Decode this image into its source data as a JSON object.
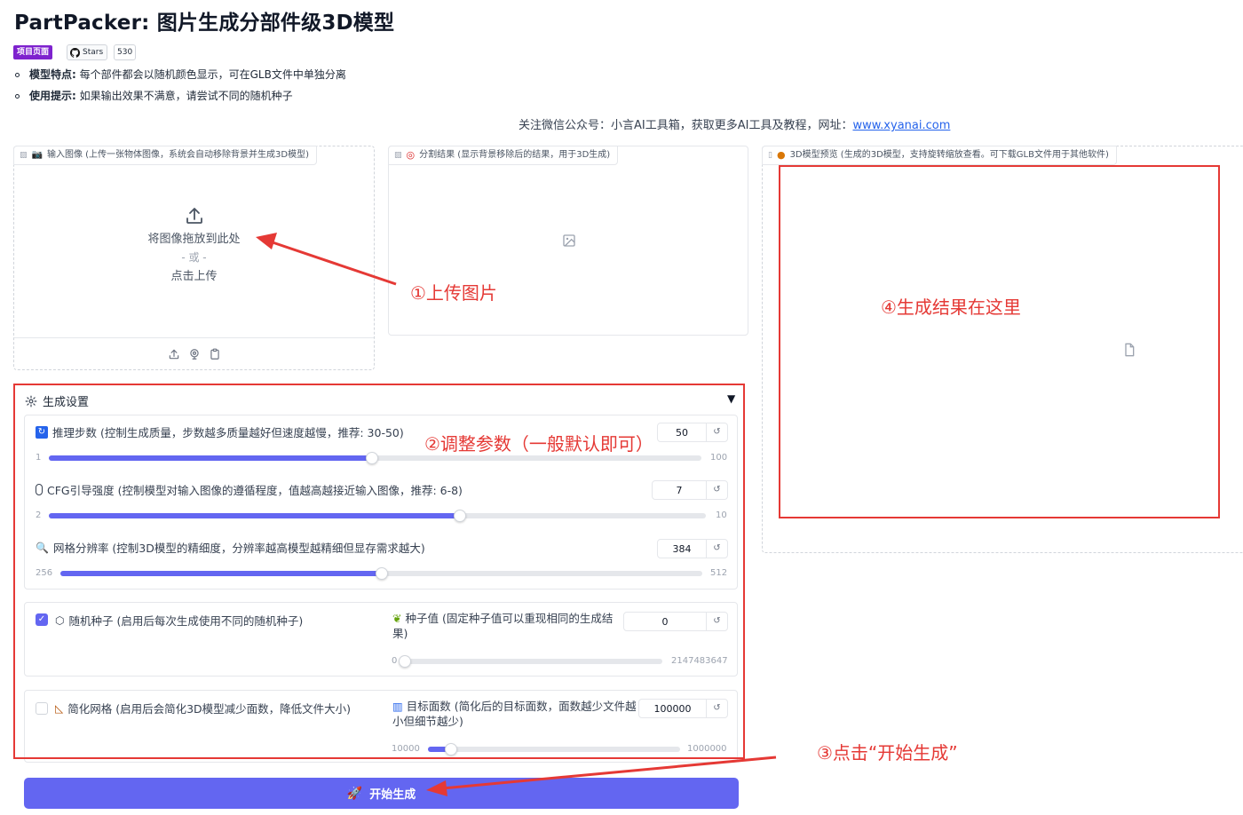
{
  "app": {
    "title": "PartPacker: 图片生成分部件级3D模型",
    "badge_project": "项目页面",
    "badge_stars_label": "Stars",
    "badge_stars_count": "530",
    "bullets": [
      {
        "bold": "模型特点:",
        "text": " 每个部件都会以随机颜色显示，可在GLB文件中单独分离"
      },
      {
        "bold": "使用提示:",
        "text": " 如果输出效果不满意，请尝试不同的随机种子"
      }
    ],
    "follow_text": "关注微信公众号：小言AI工具箱，获取更多AI工具及教程，网址：",
    "follow_link": "www.xyanai.com"
  },
  "input_panel": {
    "label": "输入图像 (上传一张物体图像，系统会自动移除背景并生成3D模型)",
    "drop_text": "将图像拖放到此处",
    "or_text": "- 或 -",
    "click_text": "点击上传"
  },
  "seg_panel": {
    "label": "分割结果 (显示背景移除后的结果，用于3D生成)"
  },
  "model_panel": {
    "label": "3D模型预览 (生成的3D模型，支持旋转缩放查看。可下载GLB文件用于其他软件)"
  },
  "settings": {
    "title": "生成设置",
    "caret": "▼",
    "steps": {
      "label": "推理步数 (控制生成质量，步数越多质量越好但速度越慢，推荐: 30-50)",
      "value": "50",
      "min": "1",
      "max": "100",
      "fraction": 0.495
    },
    "cfg": {
      "label": "CFG引导强度 (控制模型对输入图像的遵循程度，值越高越接近输入图像，推荐: 6-8)",
      "value": "7",
      "min": "2",
      "max": "10",
      "fraction": 0.625
    },
    "grid": {
      "label": "网格分辨率 (控制3D模型的精细度，分辨率越高模型越精细但显存需求越大)",
      "value": "384",
      "min": "256",
      "max": "512",
      "fraction": 0.5
    },
    "random_seed": {
      "label": "随机种子 (启用后每次生成使用不同的随机种子)",
      "checked": true
    },
    "seed": {
      "label": "种子值 (固定种子值可以重现相同的生成结果)",
      "value": "0",
      "min": "0",
      "max": "2147483647",
      "fraction": 0.0
    },
    "simplify": {
      "label": "简化网格 (启用后会简化3D模型减少面数，降低文件大小)",
      "checked": false
    },
    "faces": {
      "label": "目标面数 (简化后的目标面数，面数越少文件越小但细节越少)",
      "value": "100000",
      "min": "10000",
      "max": "1000000",
      "fraction": 0.091
    }
  },
  "generate_button": "开始生成",
  "annotations": {
    "upload": "①上传图片",
    "params": "②调整参数（一般默认即可）",
    "click": "③点击“开始生成”",
    "result": "④生成结果在这里"
  },
  "colors": {
    "accent": "#6366f1",
    "badge_purple": "#7e22ce",
    "annotation_red": "#e53935",
    "link": "#2563eb"
  }
}
